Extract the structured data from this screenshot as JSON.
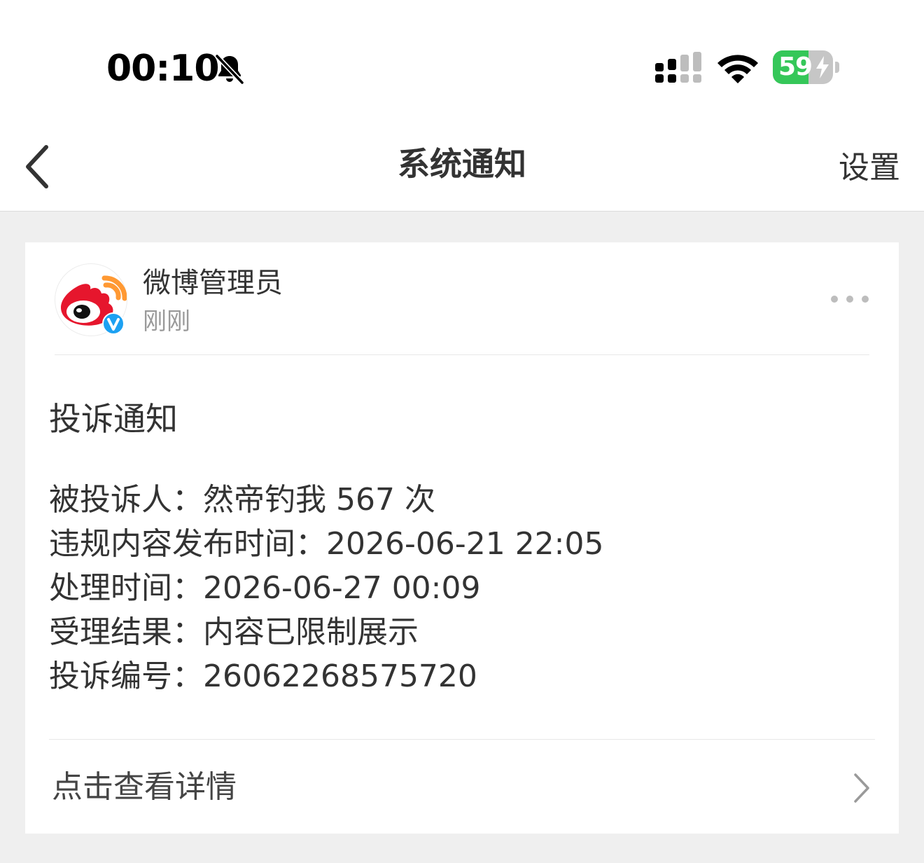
{
  "status_bar": {
    "time": "00:10",
    "battery_level": "59",
    "battery_fraction": 0.59,
    "bell_icon": "bell-slash-icon",
    "signal_icon": "cellular-signal-icon",
    "wifi_icon": "wifi-icon",
    "charging_icon": "charging-bolt-icon"
  },
  "nav": {
    "back_icon": "chevron-left-icon",
    "title": "系统通知",
    "settings_label": "设置"
  },
  "message": {
    "sender_name": "微博管理员",
    "sender_time": "刚刚",
    "avatar_icon": "weibo-logo-icon",
    "verified_icon": "verified-badge-icon",
    "more_icon": "more-dots-icon",
    "title": "投诉通知",
    "lines": [
      "被投诉人：然帝钓我 567 次",
      "违规内容发布时间：2026-06-21 22:05",
      "处理时间：2026-06-27 00:09",
      "受理结果：内容已限制展示",
      "投诉编号：26062268575720"
    ],
    "detail_label": "点击查看详情",
    "detail_icon": "chevron-right-icon"
  },
  "colors": {
    "background": "#efefef",
    "card": "#ffffff",
    "battery_green": "#35c759",
    "weibo_red": "#e6162d",
    "weibo_orange": "#ff9933",
    "verified_blue": "#1da1f2",
    "secondary_text": "#9a9a9a"
  }
}
